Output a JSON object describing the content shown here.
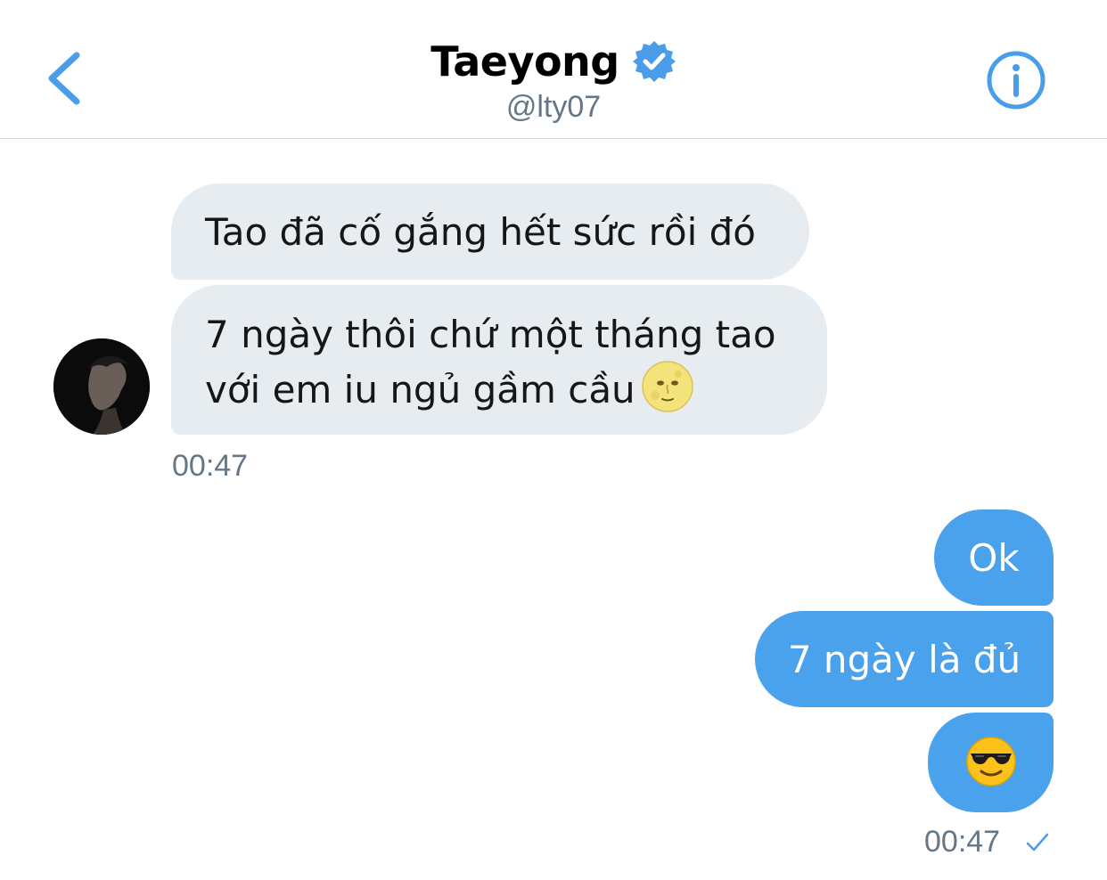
{
  "header": {
    "title": "Taeyong",
    "handle": "@lty07",
    "back_icon": "chevron-left-icon",
    "verified_icon": "verified-badge-icon",
    "info_icon": "info-icon"
  },
  "conversation": {
    "incoming": {
      "messages": [
        {
          "text": "Tao đã cố gắng hết sức rồi đó"
        },
        {
          "line1": "7 ngày thôi chứ một tháng tao",
          "line2": "với em iu ngủ gầm cầu",
          "emoji": "full-moon-face-emoji"
        }
      ],
      "timestamp": "00:47"
    },
    "outgoing": {
      "messages": [
        {
          "text": "Ok"
        },
        {
          "text": "7 ngày là đủ"
        },
        {
          "emoji": "sunglasses-face-emoji"
        }
      ],
      "timestamp": "00:47",
      "status_icon": "checkmark-icon"
    }
  },
  "colors": {
    "accent": "#1da1f2",
    "outgoing_bubble": "#4aa1ec",
    "incoming_bubble": "#e6ecf0",
    "secondary_text": "#657786"
  }
}
